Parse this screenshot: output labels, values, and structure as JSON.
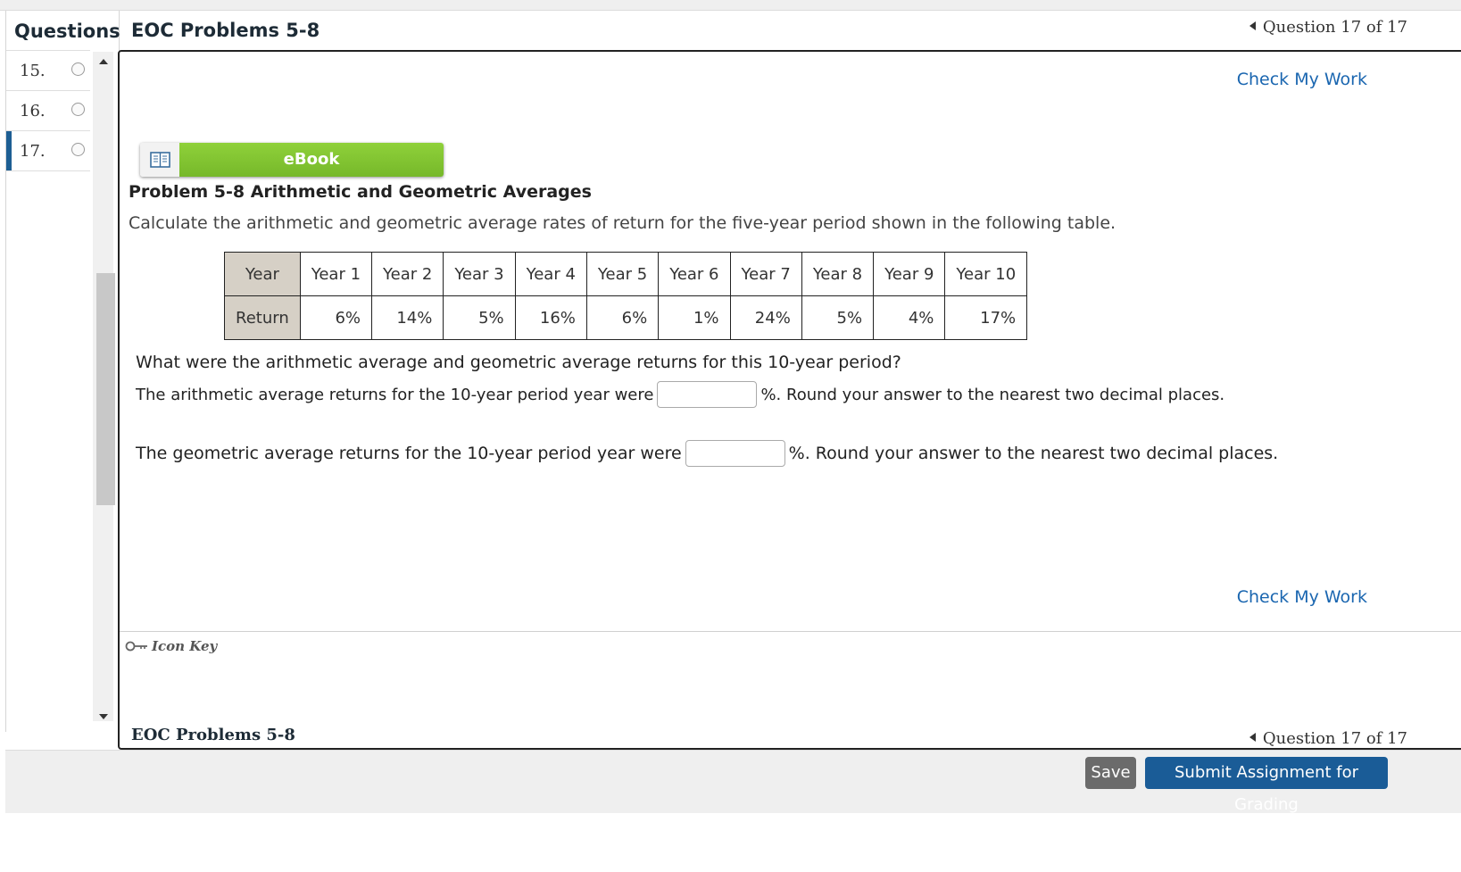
{
  "sidebar": {
    "title": "Questions",
    "items": [
      {
        "number": "15."
      },
      {
        "number": "16."
      },
      {
        "number": "17."
      }
    ]
  },
  "header": {
    "assignment_title": "EOC Problems 5-8",
    "question_nav": "Question 17 of 17"
  },
  "main": {
    "check_work_label": "Check My Work",
    "ebook_label": "eBook",
    "problem_title": "Problem 5-8 Arithmetic and Geometric Averages",
    "problem_description": "Calculate the arithmetic and geometric average rates of return for the five-year period shown in the following table.",
    "table": {
      "header_label": "Year",
      "row_label": "Return",
      "years": [
        "Year 1",
        "Year 2",
        "Year 3",
        "Year 4",
        "Year 5",
        "Year 6",
        "Year 7",
        "Year 8",
        "Year 9",
        "Year 10"
      ],
      "returns": [
        "6%",
        "14%",
        "5%",
        "16%",
        "6%",
        "1%",
        "24%",
        "5%",
        "4%",
        "17%"
      ]
    },
    "question": "What were the arithmetic average and geometric average returns for this 10-year period?",
    "arithmetic": {
      "prefix": "The arithmetic average returns for the 10-year period year were",
      "value": "",
      "suffix": "%. Round your answer to the nearest two decimal places."
    },
    "geometric": {
      "prefix": "The geometric average returns for the 10-year period year were",
      "value": "",
      "suffix": "%. Round your answer to the nearest two decimal places."
    },
    "icon_key_label": "Icon Key"
  },
  "footer": {
    "assignment_title": "EOC Problems 5-8",
    "question_nav": "Question 17 of 17",
    "save_label": "Save",
    "submit_label": "Submit Assignment for Grading"
  },
  "colors": {
    "accent_blue": "#1a5c97",
    "link_blue": "#1a66b0",
    "ebook_green": "#7dc12f",
    "active_marker": "#1d5e93"
  }
}
